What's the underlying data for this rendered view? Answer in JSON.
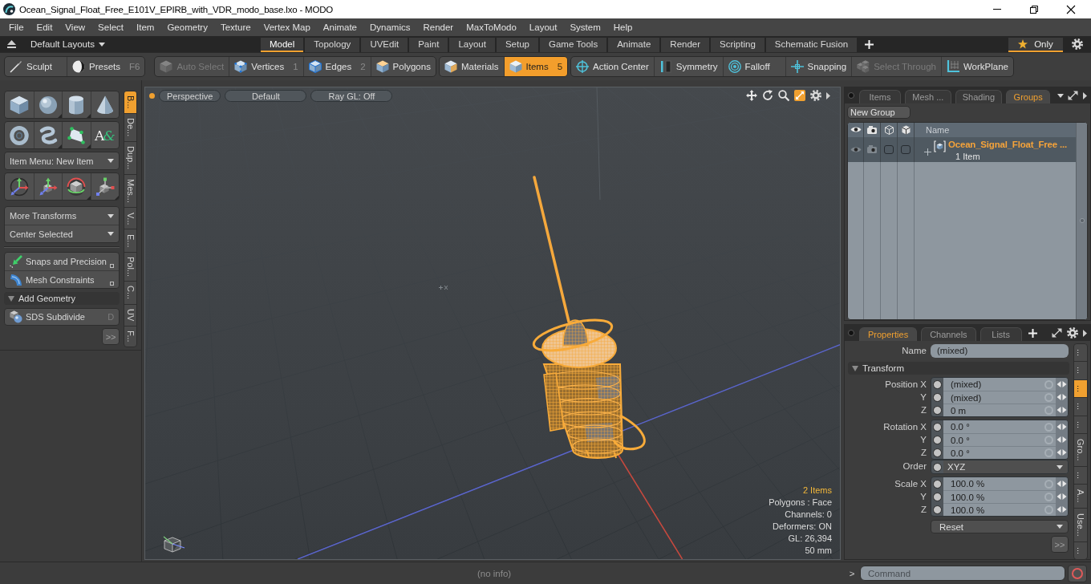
{
  "window": {
    "title": "Ocean_Signal_Float_Free_E101V_EPIRB_with_VDR_modo_base.lxo - MODO"
  },
  "menu_bar": {
    "items": [
      "File",
      "Edit",
      "View",
      "Select",
      "Item",
      "Geometry",
      "Texture",
      "Vertex Map",
      "Animate",
      "Dynamics",
      "Render",
      "MaxToModo",
      "Layout",
      "System",
      "Help"
    ]
  },
  "layout_bar": {
    "layouts_menu": "Default Layouts",
    "tabs": [
      {
        "label": "Model",
        "selected": true
      },
      {
        "label": "Topology",
        "selected": false
      },
      {
        "label": "UVEdit",
        "selected": false
      },
      {
        "label": "Paint",
        "selected": false
      },
      {
        "label": "Layout",
        "selected": false
      },
      {
        "label": "Setup",
        "selected": false
      },
      {
        "label": "Game Tools",
        "selected": false
      },
      {
        "label": "Animate",
        "selected": false
      },
      {
        "label": "Render",
        "selected": false
      },
      {
        "label": "Scripting",
        "selected": false
      },
      {
        "label": "Schematic Fusion",
        "selected": false
      }
    ],
    "only_filter": {
      "label": "Only",
      "on": true
    }
  },
  "toolbar": {
    "groups": [
      {
        "buttons": [
          {
            "label": "Sculpt",
            "selected": false,
            "disabled": false
          },
          {
            "label": "Presets",
            "shortcut": "F6",
            "selected": false,
            "disabled": false
          }
        ]
      },
      {
        "buttons": [
          {
            "label": "Auto Select",
            "selected": false,
            "disabled": true
          },
          {
            "label": "Vertices",
            "shortcut": "1",
            "selected": false,
            "disabled": false
          },
          {
            "label": "Edges",
            "shortcut": "2",
            "selected": false,
            "disabled": false
          },
          {
            "label": "Polygons",
            "selected": false,
            "disabled": false
          }
        ]
      },
      {
        "buttons": [
          {
            "label": "Materials",
            "selected": false,
            "disabled": false
          },
          {
            "label": "Items",
            "shortcut": "5",
            "selected": true,
            "disabled": false
          }
        ]
      },
      {
        "buttons": [
          {
            "label": "Action Center",
            "selected": false,
            "disabled": false
          },
          {
            "label": "Symmetry",
            "selected": false,
            "disabled": false
          },
          {
            "label": "Falloff",
            "selected": false,
            "disabled": false
          },
          {
            "label": "Snapping",
            "selected": false,
            "disabled": false
          },
          {
            "label": "Select Through",
            "selected": false,
            "disabled": true
          },
          {
            "label": "WorkPlane",
            "selected": false,
            "disabled": false
          }
        ]
      }
    ]
  },
  "tool_palette": {
    "text_tool_glyph": "A&",
    "item_menu": "Item Menu: New Item",
    "transform_menus": [
      "More Transforms",
      "Center Selected"
    ],
    "toggles": [
      "Snaps and Precision",
      "Mesh Constraints"
    ],
    "section": {
      "label": "Add Geometry",
      "expanded": true
    },
    "section_tools": [
      {
        "label": "SDS Subdivide",
        "shortcut": "D"
      }
    ],
    "more_button": ">>",
    "side_tabs": [
      {
        "label": "B...",
        "selected": true
      },
      {
        "label": "De...",
        "selected": false
      },
      {
        "label": "Dup...",
        "selected": false
      },
      {
        "label": "Mes...",
        "selected": false
      },
      {
        "label": "V...",
        "selected": false
      },
      {
        "label": "E...",
        "selected": false
      },
      {
        "label": "Pol...",
        "selected": false
      },
      {
        "label": "C...",
        "selected": false
      },
      {
        "label": "UV",
        "selected": false
      },
      {
        "label": "F...",
        "selected": false
      }
    ]
  },
  "viewport": {
    "view_buttons": [
      "Perspective",
      "Default",
      "Ray GL: Off"
    ],
    "stats": [
      {
        "text": "2 Items",
        "highlighted": true
      },
      {
        "text": "Polygons : Face",
        "highlighted": false
      },
      {
        "text": "Channels: 0",
        "highlighted": false
      },
      {
        "text": "Deformers: ON",
        "highlighted": false
      },
      {
        "text": "GL: 26,394",
        "highlighted": false
      },
      {
        "text": "50 mm",
        "highlighted": false
      }
    ]
  },
  "items_panel": {
    "tabs": [
      {
        "label": "Items",
        "selected": false
      },
      {
        "label": "Mesh ...",
        "selected": false
      },
      {
        "label": "Shading",
        "selected": false
      },
      {
        "label": "Groups",
        "selected": true
      }
    ],
    "new_group_button": "New Group",
    "name_column": "Name",
    "groups": [
      {
        "name": "Ocean_Signal_Float_Free ...",
        "count": "1 Item",
        "selected": true,
        "expanded": false
      }
    ]
  },
  "properties_panel": {
    "tabs": [
      {
        "label": "Properties",
        "selected": true
      },
      {
        "label": "Channels",
        "selected": false
      },
      {
        "label": "Lists",
        "selected": false
      }
    ],
    "name_field": {
      "label": "Name",
      "value": "(mixed)"
    },
    "section": {
      "label": "Transform",
      "expanded": true
    },
    "transform": [
      {
        "kind": "channels",
        "rows": [
          {
            "label": "Position X",
            "value": "(mixed)"
          },
          {
            "label": "Y",
            "value": "(mixed)"
          },
          {
            "label": "Z",
            "value": "0 m"
          }
        ]
      },
      {
        "kind": "channels",
        "rows": [
          {
            "label": "Rotation X",
            "value": "0.0 °"
          },
          {
            "label": "Y",
            "value": "0.0 °"
          },
          {
            "label": "Z",
            "value": "0.0 °"
          }
        ]
      },
      {
        "kind": "choice",
        "label": "Order",
        "value": "XYZ"
      },
      {
        "kind": "channels",
        "rows": [
          {
            "label": "Scale X",
            "value": "100.0 %"
          },
          {
            "label": "Y",
            "value": "100.0 %"
          },
          {
            "label": "Z",
            "value": "100.0 %"
          }
        ]
      }
    ],
    "reset_menu": "Reset",
    "more_button": ">>",
    "side_tabs": [
      {
        "label": "...",
        "selected": false
      },
      {
        "label": "...",
        "selected": false
      },
      {
        "label": "...",
        "selected": true
      },
      {
        "label": "...",
        "selected": false
      },
      {
        "label": "...",
        "selected": false
      },
      {
        "label": "Gro...",
        "selected": false
      },
      {
        "label": "...",
        "selected": false
      },
      {
        "label": "A...",
        "selected": false
      },
      {
        "label": "Use...",
        "selected": false
      },
      {
        "label": "...",
        "selected": false
      }
    ]
  },
  "status_bar": {
    "info": "(no info)",
    "prompt": ">",
    "command": {
      "placeholder": "Command"
    }
  }
}
